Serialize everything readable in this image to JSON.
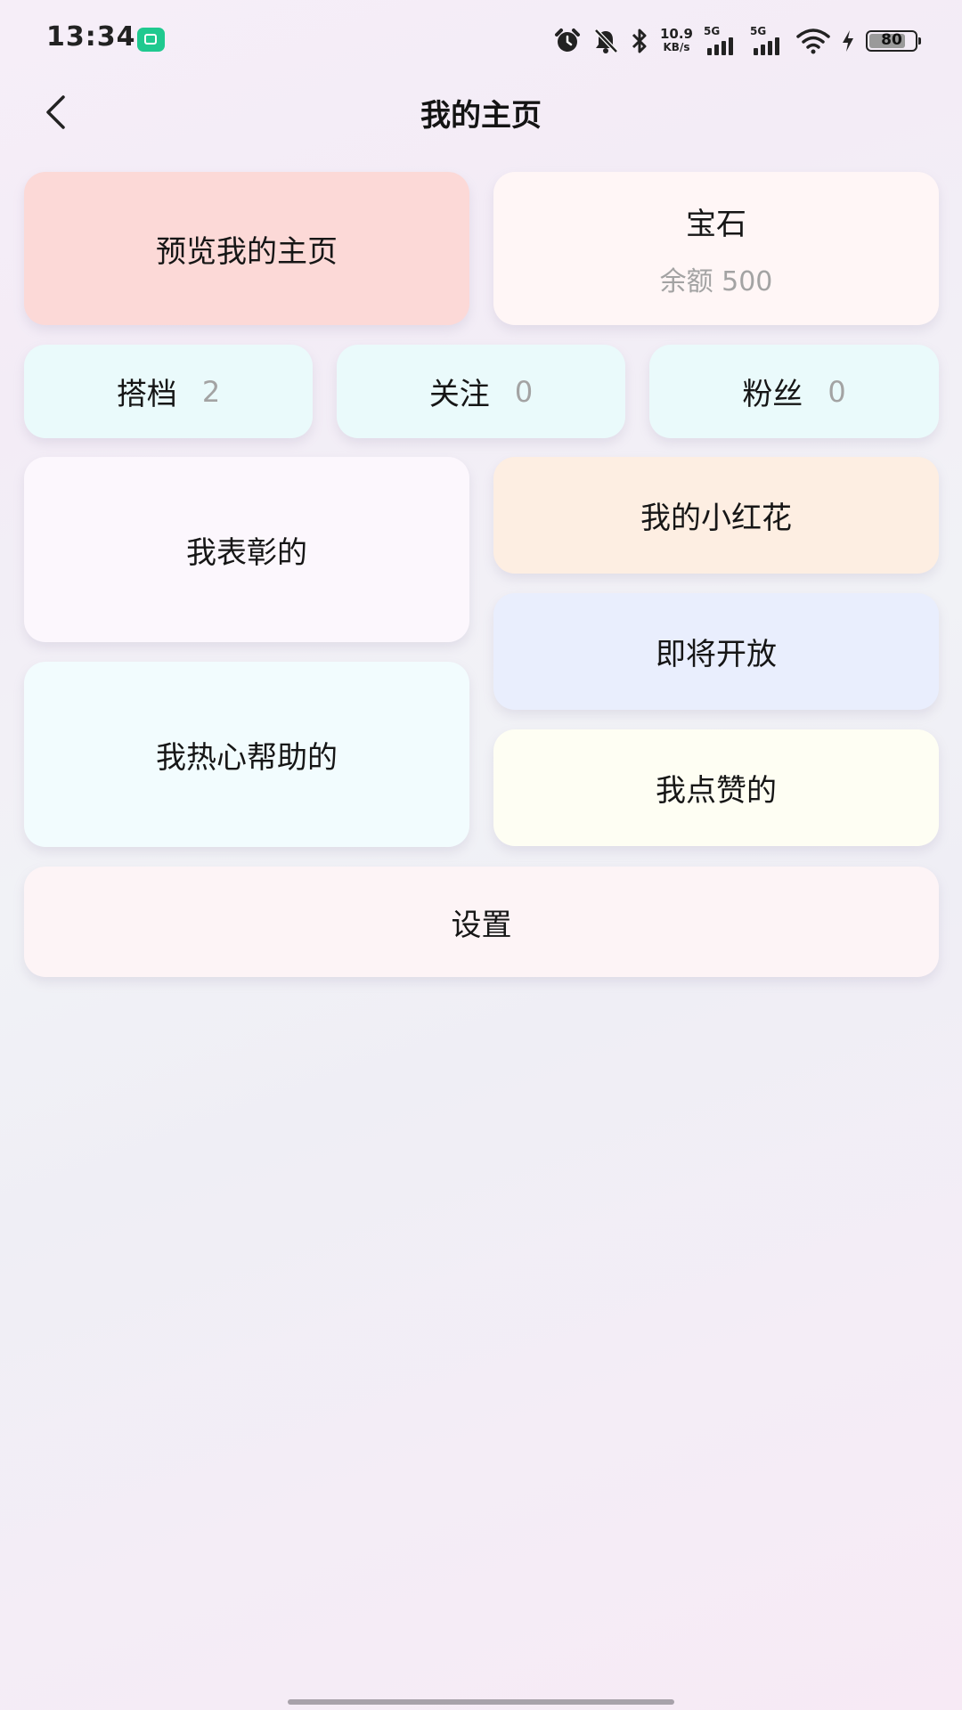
{
  "status_bar": {
    "time": "13:34",
    "net_speed_value": "10.9",
    "net_speed_unit": "KB/s",
    "sim1_label": "5G",
    "sim2_label": "5G",
    "battery_level": "80",
    "battery_fraction": 0.8
  },
  "header": {
    "title": "我的主页"
  },
  "cards": {
    "preview": {
      "label": "预览我的主页",
      "color": "#fcd9d7"
    },
    "gems": {
      "label": "宝石",
      "balance": "余额 500",
      "color": "#fff6f6"
    },
    "partners": {
      "label": "搭档",
      "count": "2",
      "color": "#eafafb"
    },
    "following": {
      "label": "关注",
      "count": "0",
      "color": "#eafafb"
    },
    "fans": {
      "label": "粉丝",
      "count": "0",
      "color": "#eafafb"
    },
    "praised": {
      "label": "我表彰的",
      "color": "#fcf7fd"
    },
    "red_flowers": {
      "label": "我的小红花",
      "color": "#fdeee2"
    },
    "coming_soon": {
      "label": "即将开放",
      "color": "#e9eefd"
    },
    "helped": {
      "label": "我热心帮助的",
      "color": "#f2fcfe"
    },
    "liked": {
      "label": "我点赞的",
      "color": "#fefef3"
    },
    "settings": {
      "label": "设置",
      "color": "#fdf4f6"
    }
  },
  "icons": {
    "back": "chevron-left-icon",
    "alarm": "alarm-icon",
    "mute": "bell-off-icon",
    "bluetooth": "bluetooth-icon",
    "wifi": "wifi-icon",
    "charging": "lightning-icon"
  }
}
